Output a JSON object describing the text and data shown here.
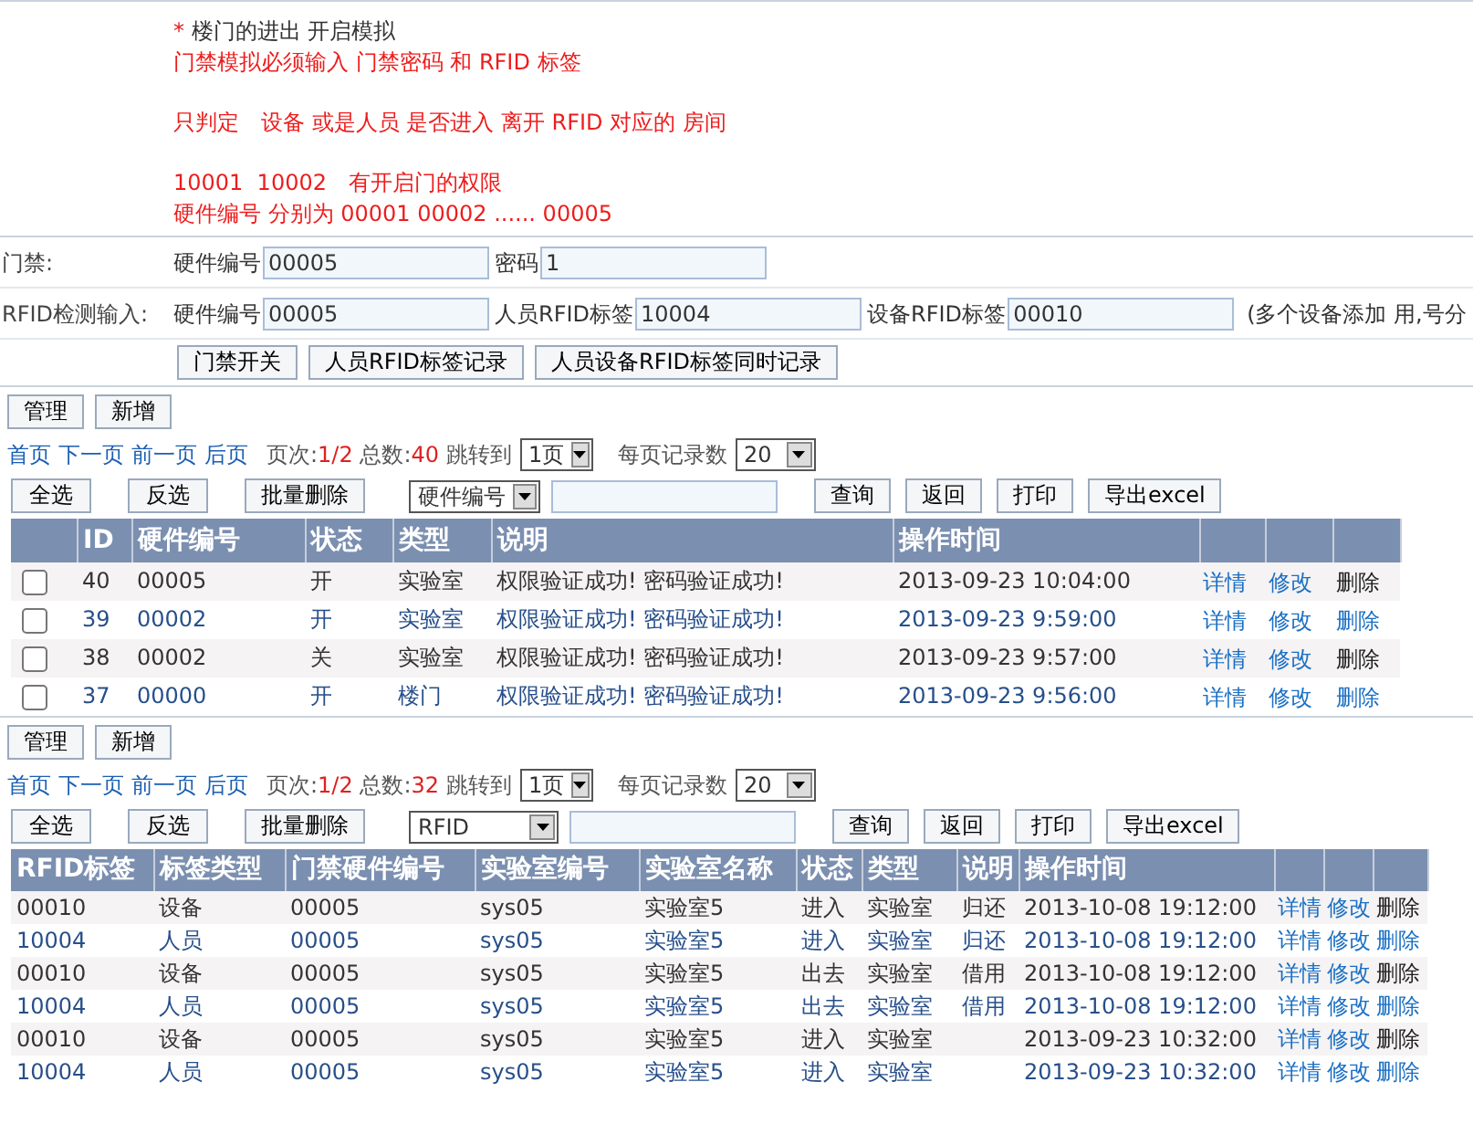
{
  "intro": {
    "mark": "*",
    "text": "楼门的进出 开启模拟"
  },
  "alerts": [
    [
      "门禁模拟必须输入 门禁密码 和 RFID 标签"
    ],
    [
      "只判定　设备 或是人员 是否进入 离开 RFID 对应的 房间"
    ],
    [
      "10001  10002　有开启门的权限",
      "硬件编号 分别为 00001 00002 ...... 00005"
    ]
  ],
  "forms": [
    {
      "label": "门禁:",
      "fields": [
        {
          "label": "硬件编号",
          "value": "00005"
        },
        {
          "label": "密码",
          "value": "1"
        }
      ]
    },
    {
      "label": "RFID检测输入:",
      "fields": [
        {
          "label": "硬件编号",
          "value": "00005"
        },
        {
          "label": "人员RFID标签",
          "value": "10004"
        },
        {
          "label": "设备RFID标签",
          "value": "00010"
        }
      ],
      "note": "(多个设备添加 用,号分"
    }
  ],
  "form_buttons": [
    "门禁开关",
    "人员RFID标签记录",
    "人员设备RFID标签同时记录"
  ],
  "sections": [
    {
      "kind": "door",
      "toolbar": [
        "管理",
        "新增"
      ],
      "pager": {
        "links": [
          "首页",
          "下一页",
          "前一页",
          "后页"
        ],
        "page_label": "页次:",
        "page": "1/2",
        "total_label": "总数:",
        "total": "40",
        "jump_label": "跳转到",
        "jump": "1页",
        "per_page_label": "每页记录数",
        "per_page": "20"
      },
      "actions": [
        "全选",
        "反选",
        "批量删除"
      ],
      "filter": "硬件编号",
      "query_buttons": [
        "查询",
        "返回",
        "打印",
        "导出excel"
      ],
      "columns": [
        "ID",
        "硬件编号",
        "状态",
        "类型",
        "说明",
        "操作时间"
      ],
      "rows": [
        {
          "checked": false,
          "cells": [
            "40",
            "00005",
            "开",
            "实验室",
            "权限验证成功! 密码验证成功!",
            "2013-09-23 10:04:00"
          ],
          "links": [
            "详情",
            "修改",
            "删除"
          ]
        },
        {
          "checked": false,
          "cells": [
            "39",
            "00002",
            "开",
            "实验室",
            "权限验证成功! 密码验证成功!",
            "2013-09-23 9:59:00"
          ],
          "links": [
            "详情",
            "修改",
            "删除"
          ]
        },
        {
          "checked": false,
          "cells": [
            "38",
            "00002",
            "关",
            "实验室",
            "权限验证成功! 密码验证成功!",
            "2013-09-23 9:57:00"
          ],
          "links": [
            "详情",
            "修改",
            "删除"
          ]
        },
        {
          "checked": false,
          "cells": [
            "37",
            "00000",
            "开",
            "楼门",
            "权限验证成功! 密码验证成功!",
            "2013-09-23 9:56:00"
          ],
          "links": [
            "详情",
            "修改",
            "删除"
          ]
        }
      ]
    },
    {
      "kind": "rfid",
      "toolbar": [
        "管理",
        "新增"
      ],
      "pager": {
        "links": [
          "首页",
          "下一页",
          "前一页",
          "后页"
        ],
        "page_label": "页次:",
        "page": "1/2",
        "total_label": "总数:",
        "total": "32",
        "jump_label": "跳转到",
        "jump": "1页",
        "per_page_label": "每页记录数",
        "per_page": "20"
      },
      "actions": [
        "全选",
        "反选",
        "批量删除"
      ],
      "filter": "RFID",
      "query_buttons": [
        "查询",
        "返回",
        "打印",
        "导出excel"
      ],
      "columns": [
        "RFID标签",
        "标签类型",
        "门禁硬件编号",
        "实验室编号",
        "实验室名称",
        "状态",
        "类型",
        "说明",
        "操作时间"
      ],
      "rows": [
        {
          "cells": [
            "00010",
            "设备",
            "00005",
            "sys05",
            "实验室5",
            "进入",
            "实验室",
            "归还",
            "2013-10-08 19:12:00"
          ],
          "links": [
            "详情",
            "修改",
            "删除"
          ]
        },
        {
          "cells": [
            "10004",
            "人员",
            "00005",
            "sys05",
            "实验室5",
            "进入",
            "实验室",
            "归还",
            "2013-10-08 19:12:00"
          ],
          "links": [
            "详情",
            "修改",
            "删除"
          ]
        },
        {
          "cells": [
            "00010",
            "设备",
            "00005",
            "sys05",
            "实验室5",
            "出去",
            "实验室",
            "借用",
            "2013-10-08 19:12:00"
          ],
          "links": [
            "详情",
            "修改",
            "删除"
          ]
        },
        {
          "cells": [
            "10004",
            "人员",
            "00005",
            "sys05",
            "实验室5",
            "出去",
            "实验室",
            "借用",
            "2013-10-08 19:12:00"
          ],
          "links": [
            "详情",
            "修改",
            "删除"
          ]
        },
        {
          "cells": [
            "00010",
            "设备",
            "00005",
            "sys05",
            "实验室5",
            "进入",
            "实验室",
            null,
            "2013-09-23 10:32:00"
          ],
          "links": [
            "详情",
            "修改",
            "删除"
          ]
        },
        {
          "cells": [
            "10004",
            "人员",
            "00005",
            "sys05",
            "实验室5",
            "进入",
            "实验室",
            null,
            "2013-09-23 10:32:00"
          ],
          "links": [
            "详情",
            "修改",
            "删除"
          ]
        }
      ]
    }
  ]
}
